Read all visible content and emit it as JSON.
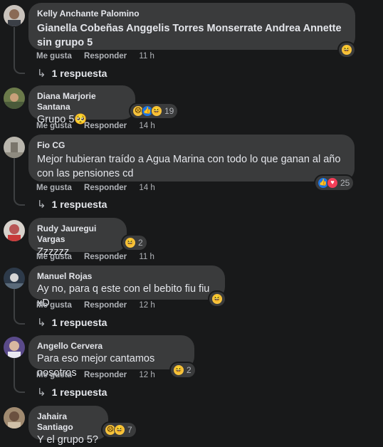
{
  "actions": {
    "like": "Me gusta",
    "reply": "Responder"
  },
  "comments": [
    {
      "author": "Kelly Anchante Palomino",
      "text": "Gianella Cobeñas Anggelis Torres Monserrate Andrea Annette sin grupo 5",
      "time": "11 h",
      "reply_label": "1 respuesta",
      "reaction_count": ""
    },
    {
      "author": "Diana Marjorie Santana",
      "text": "Grupo 5🥺",
      "time": "14 h",
      "reply_label": "",
      "reaction_count": "19"
    },
    {
      "author": "Fio CG",
      "text": "Mejor hubieran traído a Agua Marina con todo lo que ganan al año con las pensiones cd",
      "time": "14 h",
      "reply_label": "1 respuesta",
      "reaction_count": "25"
    },
    {
      "author": "Rudy Jauregui Vargas",
      "text": "Zzzzzz",
      "time": "11 h",
      "reply_label": "",
      "reaction_count": "2"
    },
    {
      "author": "Manuel Rojas",
      "text": "Ay no, para q este con el bebito fiu fiu xD",
      "time": "12 h",
      "reply_label": "1 respuesta",
      "reaction_count": ""
    },
    {
      "author": "Angello Cervera",
      "text": "Para eso mejor cantamos nosotros",
      "time": "12 h",
      "reply_label": "1 respuesta",
      "reaction_count": "2"
    },
    {
      "author": "Jahaira Santiago",
      "text": "Y el grupo 5?",
      "time": "",
      "reply_label": "",
      "reaction_count": "7"
    }
  ],
  "colors": {
    "background": "#18191a",
    "bubble": "#3a3b3c",
    "text": "#e4e6eb",
    "muted": "#b0b3b8",
    "like": "#1b74e4",
    "love": "#f33e58",
    "haha": "#f7c33c"
  }
}
